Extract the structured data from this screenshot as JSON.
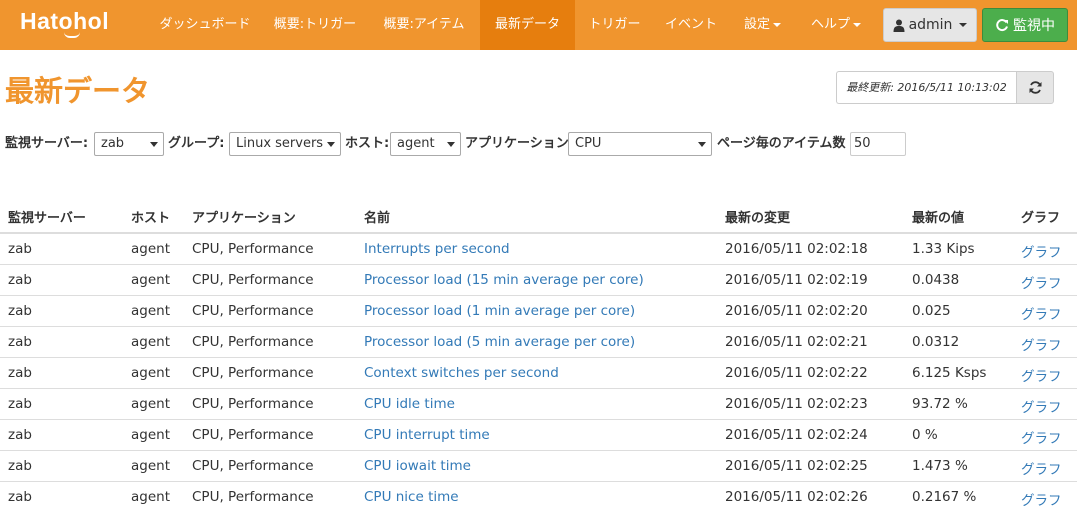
{
  "app": {
    "brand": "Hatohol"
  },
  "nav": {
    "items": [
      {
        "label": "ダッシュボード",
        "active": false
      },
      {
        "label": "概要:トリガー",
        "active": false
      },
      {
        "label": "概要:アイテム",
        "active": false
      },
      {
        "label": "最新データ",
        "active": true
      },
      {
        "label": "トリガー",
        "active": false
      },
      {
        "label": "イベント",
        "active": false
      },
      {
        "label": "設定",
        "active": false
      },
      {
        "label": "ヘルプ",
        "active": false
      }
    ],
    "user_label": "admin",
    "monitor_label": "監視中"
  },
  "page": {
    "title": "最新データ",
    "last_update": "最終更新: 2016/5/11 10:13:02"
  },
  "filters": {
    "server_label": "監視サーバー:",
    "server_value": "zab",
    "group_label": "グループ:",
    "group_value": "Linux servers",
    "host_label": "ホスト:",
    "host_value": "agent",
    "app_label": "アプリケーション:",
    "app_value": "CPU",
    "per_page_label": "ページ毎のアイテム数",
    "per_page_value": "50"
  },
  "table": {
    "headers": [
      "監視サーバー",
      "ホスト",
      "アプリケーション",
      "名前",
      "最新の変更",
      "最新の値",
      "グラフ"
    ],
    "rows": [
      {
        "server": "zab",
        "host": "agent",
        "application": "CPU, Performance",
        "name": "Interrupts per second",
        "changed": "2016/05/11 02:02:18",
        "value": "1.33 Kips",
        "graph": "グラフ"
      },
      {
        "server": "zab",
        "host": "agent",
        "application": "CPU, Performance",
        "name": "Processor load (15 min average per core)",
        "changed": "2016/05/11 02:02:19",
        "value": "0.0438",
        "graph": "グラフ"
      },
      {
        "server": "zab",
        "host": "agent",
        "application": "CPU, Performance",
        "name": "Processor load (1 min average per core)",
        "changed": "2016/05/11 02:02:20",
        "value": "0.025",
        "graph": "グラフ"
      },
      {
        "server": "zab",
        "host": "agent",
        "application": "CPU, Performance",
        "name": "Processor load (5 min average per core)",
        "changed": "2016/05/11 02:02:21",
        "value": "0.0312",
        "graph": "グラフ"
      },
      {
        "server": "zab",
        "host": "agent",
        "application": "CPU, Performance",
        "name": "Context switches per second",
        "changed": "2016/05/11 02:02:22",
        "value": "6.125 Ksps",
        "graph": "グラフ"
      },
      {
        "server": "zab",
        "host": "agent",
        "application": "CPU, Performance",
        "name": "CPU idle time",
        "changed": "2016/05/11 02:02:23",
        "value": "93.72 %",
        "graph": "グラフ"
      },
      {
        "server": "zab",
        "host": "agent",
        "application": "CPU, Performance",
        "name": "CPU interrupt time",
        "changed": "2016/05/11 02:02:24",
        "value": "0 %",
        "graph": "グラフ"
      },
      {
        "server": "zab",
        "host": "agent",
        "application": "CPU, Performance",
        "name": "CPU iowait time",
        "changed": "2016/05/11 02:02:25",
        "value": "1.473 %",
        "graph": "グラフ"
      },
      {
        "server": "zab",
        "host": "agent",
        "application": "CPU, Performance",
        "name": "CPU nice time",
        "changed": "2016/05/11 02:02:26",
        "value": "0.2167 %",
        "graph": "グラフ"
      }
    ]
  },
  "colors": {
    "navbar": "#f0952e",
    "navbar_active": "#e67e0e",
    "title": "#f0952e",
    "link": "#337ab7",
    "monitor_button": "#4cae4c"
  },
  "icons": {
    "user": "user-icon",
    "refresh": "refresh-icon",
    "monitor": "refresh-icon",
    "dropdown": "caret-down-icon"
  }
}
